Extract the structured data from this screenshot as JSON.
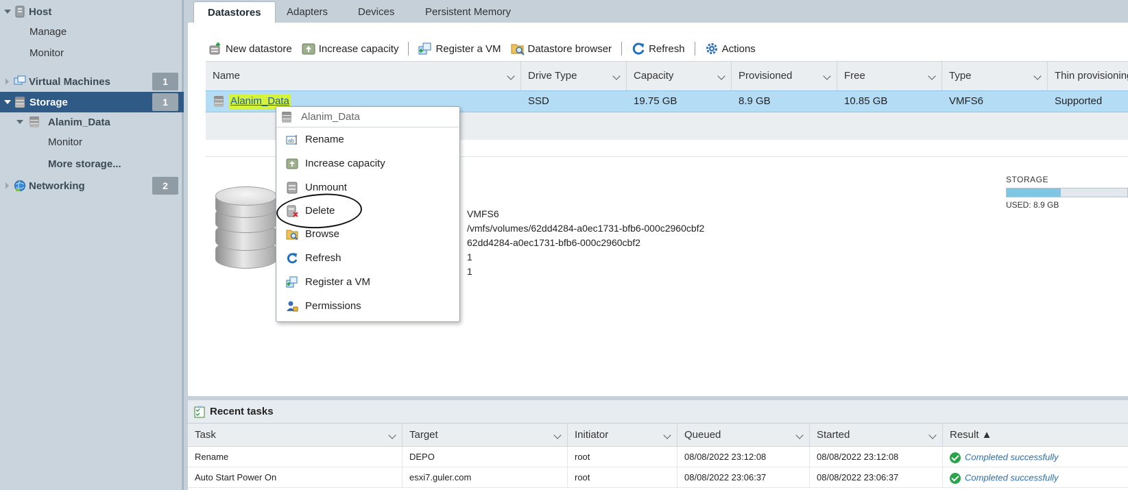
{
  "sidebar": {
    "host": "Host",
    "manage": "Manage",
    "monitor": "Monitor",
    "virtual_machines": "Virtual Machines",
    "virtual_machines_count": "1",
    "storage": "Storage",
    "storage_count": "1",
    "datastore": "Alanim_Data",
    "datastore_monitor": "Monitor",
    "more_storage": "More storage...",
    "networking": "Networking",
    "networking_count": "2"
  },
  "tabs": [
    "Datastores",
    "Adapters",
    "Devices",
    "Persistent Memory"
  ],
  "toolbar": {
    "new_datastore": "New datastore",
    "increase_capacity": "Increase capacity",
    "register_vm": "Register a VM",
    "datastore_browser": "Datastore browser",
    "refresh": "Refresh",
    "actions": "Actions"
  },
  "grid": {
    "columns": [
      "Name",
      "Drive Type",
      "Capacity",
      "Provisioned",
      "Free",
      "Type",
      "Thin provisioning"
    ],
    "rows": [
      [
        "Alanim_Data",
        "SSD",
        "19.75 GB",
        "8.9 GB",
        "10.85 GB",
        "VMFS6",
        "Supported"
      ]
    ]
  },
  "details": {
    "type": "VMFS6",
    "location": "/vmfs/volumes/62dd4284-a0ec1731-bfb6-000c2960cbf2",
    "uuid": "62dd4284-a0ec1731-bfb6-000c2960cbf2",
    "hosts": "1",
    "vms": "1"
  },
  "storage_meter": {
    "label": "STORAGE",
    "used_text": "USED: 8.9 GB",
    "used_fraction": 0.45
  },
  "context_menu": {
    "title": "Alanim_Data",
    "items": [
      "Rename",
      "Increase capacity",
      "Unmount",
      "Delete",
      "Browse",
      "Refresh",
      "Register a VM",
      "Permissions"
    ]
  },
  "recent_tasks": {
    "title": "Recent tasks",
    "columns": [
      "Task",
      "Target",
      "Initiator",
      "Queued",
      "Started",
      "Result ▲"
    ],
    "rows": [
      [
        "Rename",
        "DEPO",
        "root",
        "08/08/2022 23:12:08",
        "08/08/2022 23:12:08",
        "Completed successfully"
      ],
      [
        "Auto Start Power On",
        "esxi7.guler.com",
        "root",
        "08/08/2022 23:06:37",
        "08/08/2022 23:06:37",
        "Completed successfully"
      ]
    ]
  },
  "colors": {
    "selected_nav": "#2f5a86",
    "selected_row": "#b5dcf5",
    "highlight": "#d4f33a",
    "success": "#2aa44a"
  }
}
